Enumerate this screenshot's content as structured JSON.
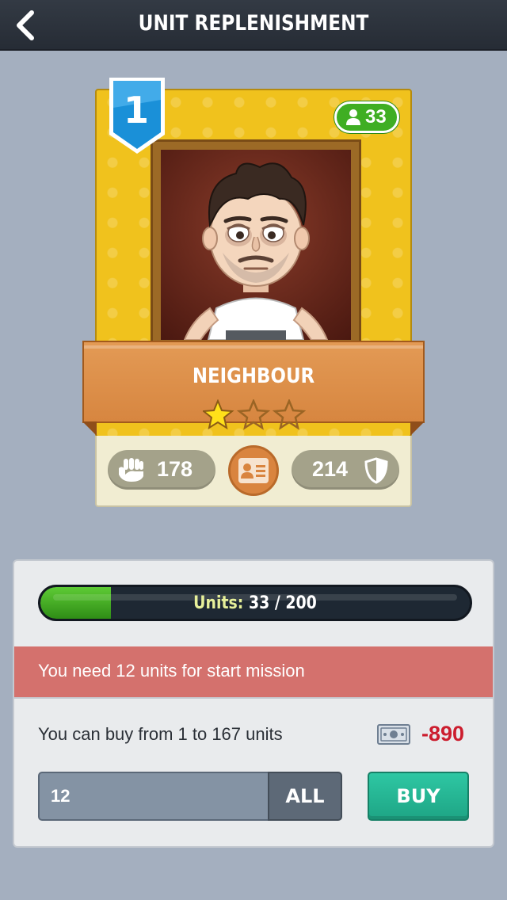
{
  "header": {
    "title": "UNIT REPLENISHMENT",
    "back_icon": "chevron-left-icon"
  },
  "card": {
    "level": "1",
    "population": "33",
    "unit_name": "NEIGHBOUR",
    "stars_filled": 1,
    "stars_total": 3,
    "attack": "178",
    "defense": "214",
    "colors": {
      "card_gold": "#f0c21d",
      "ribbon": "#d98a45",
      "badge_blue": "#1a90d8",
      "population_green": "#3fae23"
    }
  },
  "panel": {
    "progress_label": "Units:",
    "progress_value": "33 / 200",
    "progress_fraction": 0.165,
    "warning": "You need 12 units for start mission",
    "buy_range": "You can buy from 1 to 167 units",
    "cost": "-890",
    "quantity": "12",
    "all_label": "ALL",
    "buy_label": "BUY"
  }
}
